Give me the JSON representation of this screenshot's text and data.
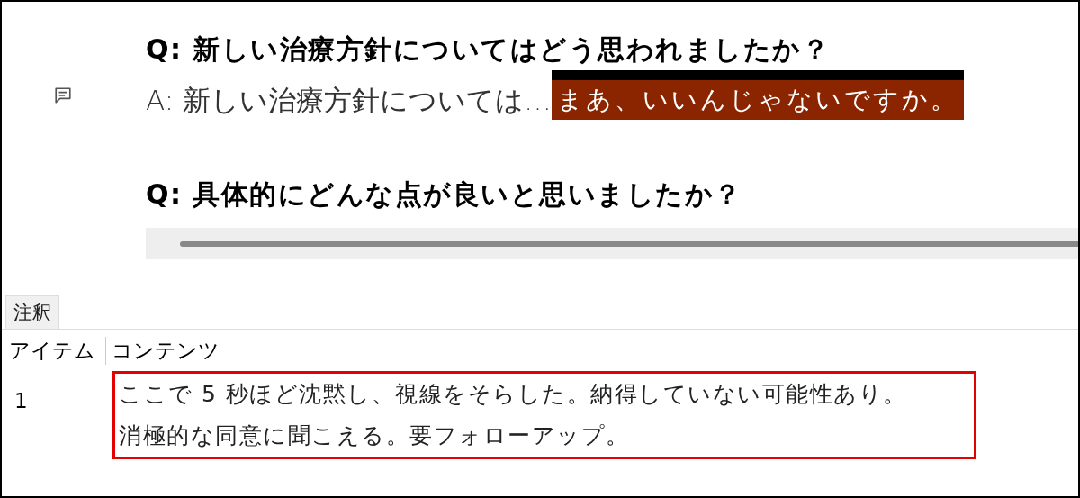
{
  "document": {
    "blocks": [
      {
        "kind": "question",
        "text": "Q: 新しい治療方針についてはどう思われましたか？"
      },
      {
        "kind": "answer",
        "text": "A: 新しい治療方針については…",
        "highlight": "まあ、いいんじゃないですか。",
        "has_comment": true
      },
      {
        "kind": "question",
        "text": "Q: 具体的にどんな点が良いと思いましたか？"
      }
    ]
  },
  "annotations": {
    "tabs": [
      {
        "label": "注釈",
        "selected": true
      }
    ],
    "columns": [
      "アイテム",
      "コンテンツ"
    ],
    "rows": [
      {
        "item": "1",
        "content_lines": [
          "ここで 5 秒ほど沈黙し、視線をそらした。納得していない可能性あり。",
          "消極的な同意に聞こえる。要フォローアップ。"
        ],
        "selected": true
      }
    ]
  }
}
